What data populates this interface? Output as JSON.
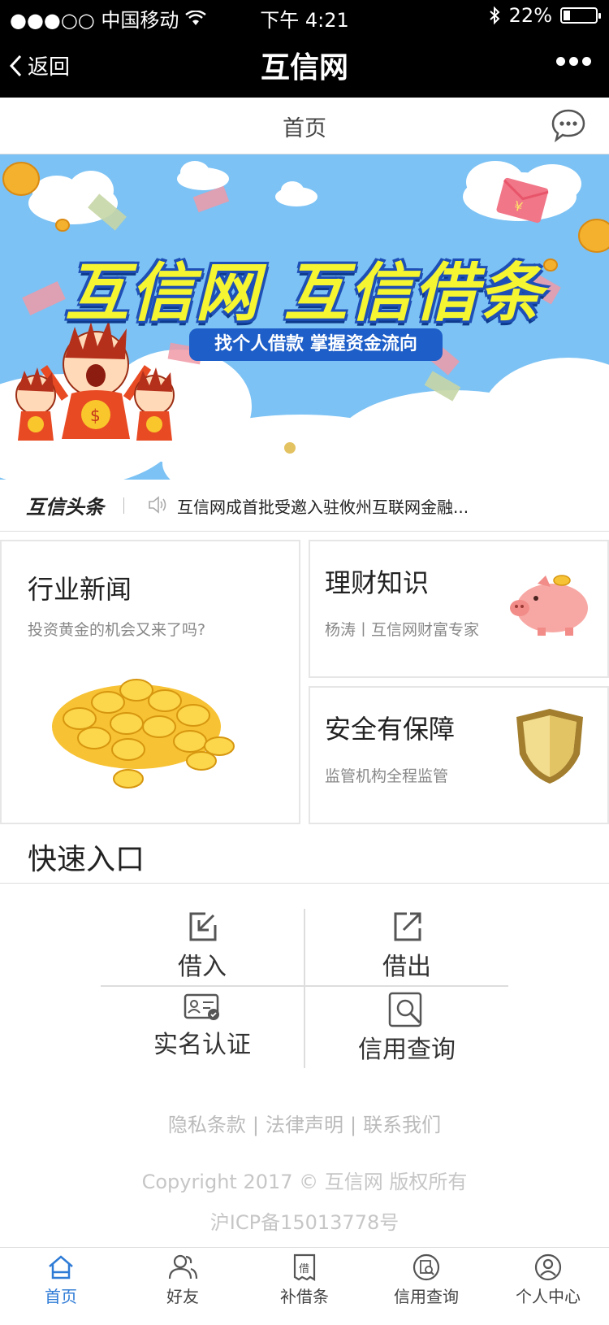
{
  "status_bar": {
    "carrier": "●●●○○ 中国移动",
    "time": "下午 4:21",
    "battery": "22%",
    "battery_level": 0.22
  },
  "nav": {
    "back_label": "返回",
    "title": "互信网",
    "more_icon": "more-dots-icon"
  },
  "page_header": {
    "title": "首页",
    "chat_icon": "chat-bubble-icon"
  },
  "banner": {
    "title": "互信网 互信借条",
    "subtitle": "找个人借款 掌握资金流向",
    "slides": 2,
    "active_slide": 0,
    "colors": {
      "sky": "#7cc2f4",
      "title": "#f5f531",
      "subtitle_bg": "#1d5ec8"
    }
  },
  "ticker": {
    "label": "互信头条",
    "text": "互信网成首批受邀入驻攸州互联网金融..."
  },
  "cards": {
    "news": {
      "title": "行业新闻",
      "subtitle": "投资黄金的机会又来了吗?"
    },
    "finance": {
      "title": "理财知识",
      "subtitle": "杨涛丨互信网财富专家"
    },
    "safe": {
      "title": "安全有保障",
      "subtitle": "监管机构全程监管"
    }
  },
  "quick": {
    "title": "快速入口",
    "items": [
      {
        "label": "借入",
        "icon": "borrow-in-icon"
      },
      {
        "label": "借出",
        "icon": "lend-out-icon"
      },
      {
        "label": "实名认证",
        "icon": "id-card-icon"
      },
      {
        "label": "信用查询",
        "icon": "credit-search-icon"
      }
    ]
  },
  "footer": {
    "links": [
      "隐私条款",
      "法律声明",
      "联系我们"
    ],
    "separator": "|",
    "copyright": "Copyright 2017 © 互信网 版权所有",
    "icp": "沪ICP备15013778号"
  },
  "tab_bar": {
    "active_color": "#2e7bd6",
    "tabs": [
      {
        "label": "首页",
        "icon": "home-icon",
        "active": true
      },
      {
        "label": "好友",
        "icon": "friends-icon",
        "active": false
      },
      {
        "label": "补借条",
        "icon": "iou-note-icon",
        "active": false
      },
      {
        "label": "信用查询",
        "icon": "credit-icon",
        "active": false
      },
      {
        "label": "个人中心",
        "icon": "user-center-icon",
        "active": false
      }
    ]
  }
}
